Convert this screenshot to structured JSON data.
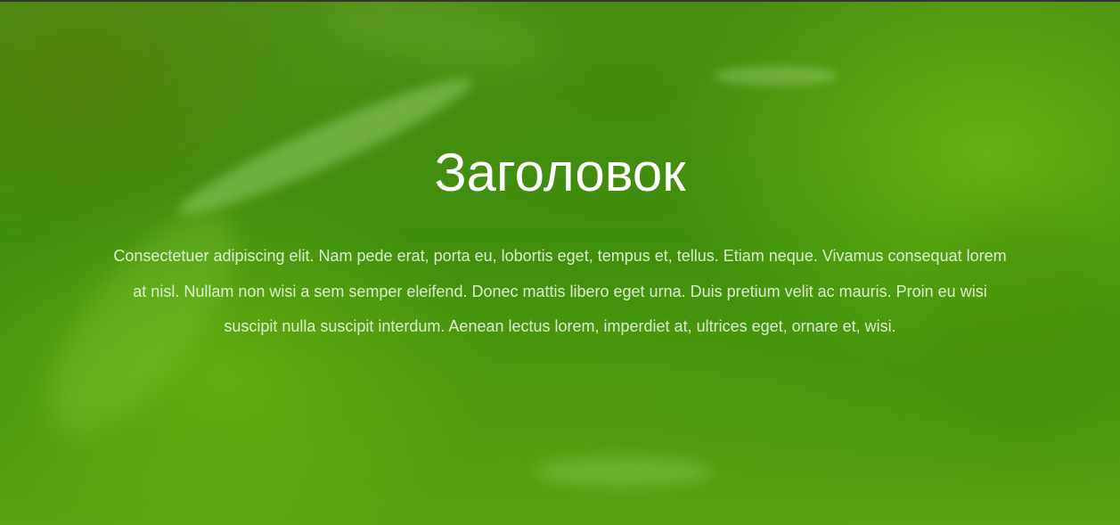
{
  "hero": {
    "title": "Заголовок",
    "text": "Consectetuer adipiscing elit. Nam pede erat, porta eu, lobortis eget, tempus et, tellus. Etiam neque. Vivamus consequat lorem at nisl. Nullam non wisi a sem semper eleifend. Donec mattis libero eget urna. Duis pretium velit ac mauris. Proin eu wisi suscipit nulla suscipit interdum. Aenean lectus lorem, imperdiet at, ultrices eget, ornare et, wisi."
  },
  "colors": {
    "title": "#ffffff",
    "text": "#f0fae6",
    "background_green": "#4a9a0f",
    "top_strip": "#333333"
  }
}
